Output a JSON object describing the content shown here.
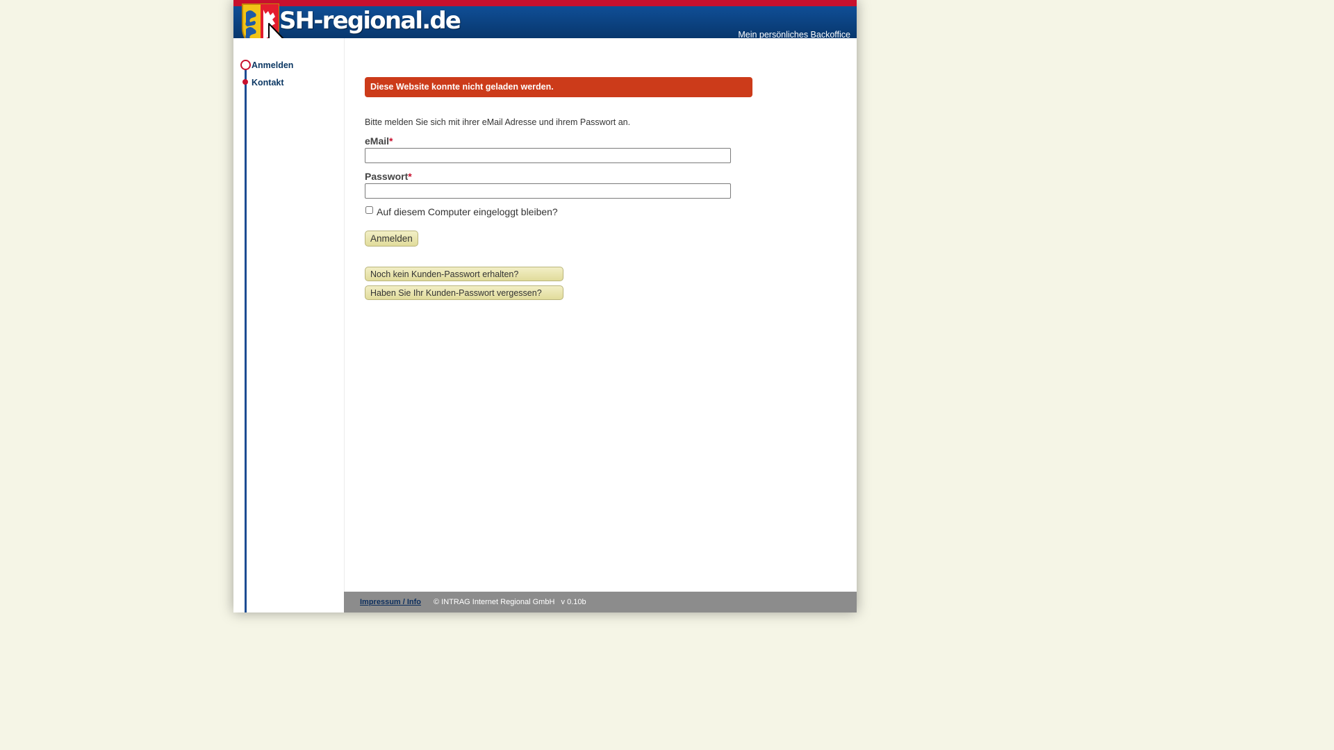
{
  "header": {
    "logo_text": "SH-regional.de",
    "tagline": "Mein persönliches Backoffice"
  },
  "sidebar": {
    "items": [
      {
        "label": "Anmelden"
      },
      {
        "label": "Kontakt"
      }
    ]
  },
  "main": {
    "error_message": "Diese Website konnte nicht geladen werden.",
    "intro": "Bitte melden Sie sich mit ihrer eMail Adresse und ihrem Passwort an.",
    "email_label": "eMail",
    "email_value": "",
    "password_label": "Passwort",
    "password_value": "",
    "required_marker": "*",
    "remember_label": "Auf diesem Computer eingeloggt bleiben?",
    "login_button": "Anmelden",
    "no_password_button": "Noch kein Kunden-Passwort erhalten?",
    "forgot_password_button": "Haben Sie Ihr Kunden-Passwort vergessen?"
  },
  "footer": {
    "impressum": "Impressum / Info",
    "copyright": "© INTRAG Internet Regional GmbH   v 0.10b"
  },
  "colors": {
    "brand_red": "#c8102e",
    "header_blue": "#0f4e96",
    "error_bg": "#cc3b1a",
    "button_bg": "#e8e4ad",
    "footer_bg": "#8c8c8c",
    "page_bg": "#f5f5e6"
  }
}
